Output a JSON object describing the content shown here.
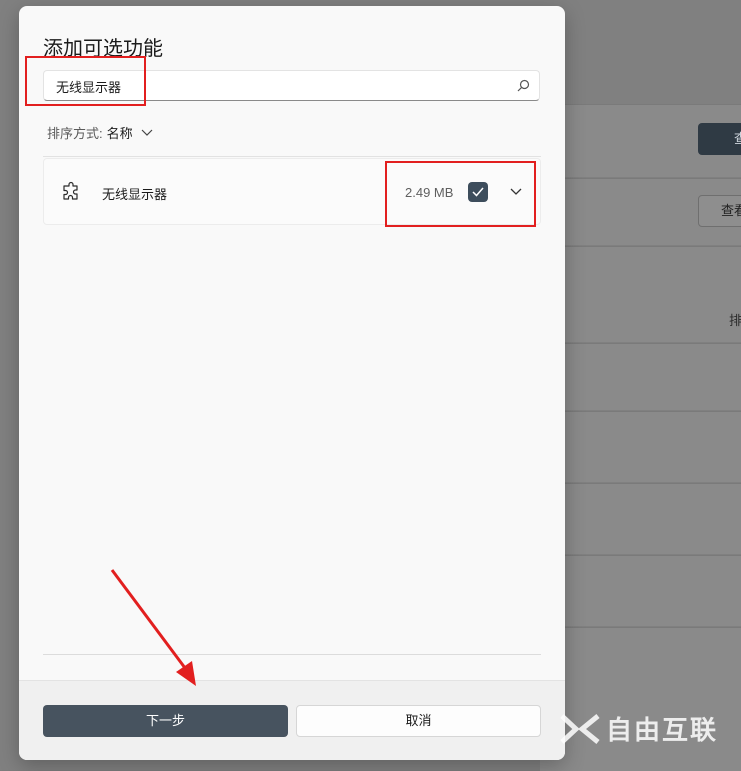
{
  "background": {
    "button_dark_label": "查",
    "button_light_label": "查看",
    "sort_partial": "排"
  },
  "dialog": {
    "title": "添加可选功能",
    "search": {
      "value": "无线显示器",
      "placeholder": ""
    },
    "sort": {
      "label": "排序方式:",
      "value": "名称"
    },
    "features": [
      {
        "name": "无线显示器",
        "size": "2.49 MB",
        "checked": true
      }
    ],
    "buttons": {
      "next": "下一步",
      "cancel": "取消"
    }
  },
  "watermark": {
    "text": "自由互联"
  },
  "colors": {
    "annotation": "#e21f1f",
    "primary_button": "#47535f",
    "checkbox": "#3d4d5c"
  }
}
